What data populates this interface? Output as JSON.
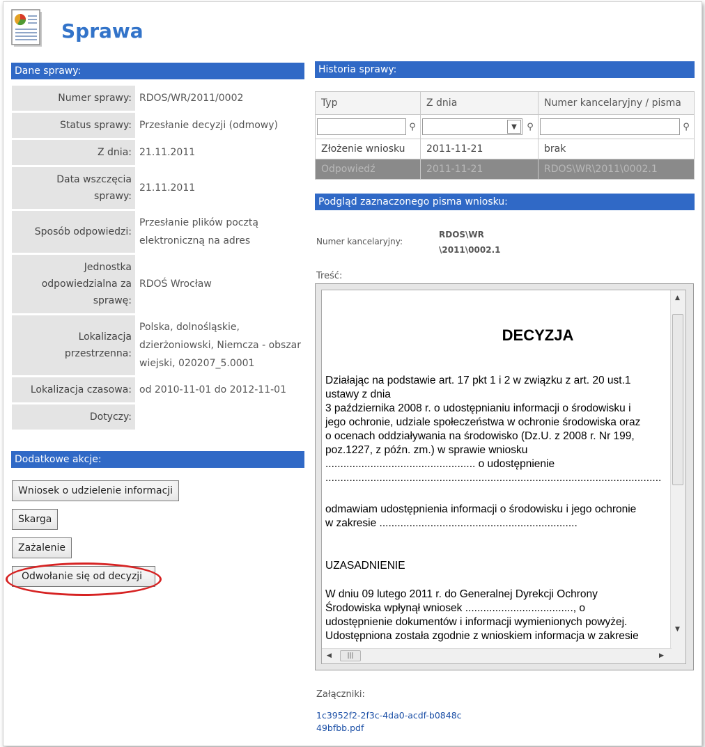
{
  "page": {
    "title": "Sprawa",
    "icon": "document-report-icon"
  },
  "details": {
    "header": "Dane sprawy:",
    "rows": [
      {
        "label": "Numer sprawy:",
        "value": "RDOS/WR/2011/0002"
      },
      {
        "label": "Status sprawy:",
        "value": "Przesłanie decyzji (odmowy)"
      },
      {
        "label": "Z dnia:",
        "value": "21.11.2011"
      },
      {
        "label": "Data wszczęcia sprawy:",
        "value": "21.11.2011"
      },
      {
        "label": "Sposób odpowiedzi:",
        "value": "Przesłanie plików pocztą elektroniczną na adres"
      },
      {
        "label": "Jednostka odpowiedzialna za sprawę:",
        "value": "RDOŚ Wrocław"
      },
      {
        "label": "Lokalizacja przestrzenna:",
        "value": "Polska, dolnośląskie, dzierżoniowski, Niemcza - obszar wiejski, 020207_5.0001"
      },
      {
        "label": "Lokalizacja czasowa:",
        "value": "od 2010-11-01 do 2012-11-01"
      },
      {
        "label": "Dotyczy:",
        "value": ""
      }
    ]
  },
  "actions": {
    "header": "Dodatkowe akcje:",
    "buttons": [
      {
        "label": "Wniosek o udzielenie informacji"
      },
      {
        "label": "Skarga"
      },
      {
        "label": "Zażalenie"
      },
      {
        "label": "Odwołanie się od decyzji"
      }
    ],
    "highlight_color": "#d62222"
  },
  "history": {
    "header": "Historia sprawy:",
    "columns": [
      "Typ",
      "Z dnia",
      "Numer kancelaryjny / pisma"
    ],
    "rows": [
      {
        "typ": "Złożenie wniosku",
        "date": "2011-11-21",
        "number": "brak"
      },
      {
        "typ": "Odpowiedź",
        "date": "2011-11-21",
        "number": "RDOS\\WR\\2011\\0002.1",
        "selected": true
      }
    ]
  },
  "preview": {
    "header": "Podgląd zaznaczonego pisma wniosku:",
    "kanc_label": "Numer kancelaryjny:",
    "kanc_value_line1": "RDOS\\WR",
    "kanc_value_line2": "\\2011\\0002.1",
    "tresc_label": "Treść:",
    "doc": {
      "heading": "DECYZJA",
      "p1": "Działając na podstawie art. 17 pkt 1 i 2 w związku z art. 20 ust.1\nustawy z dnia\n3 października 2008 r. o udostępnianiu informacji o środowisku i\njego ochronie, udziale społeczeństwa w ochronie środowiska oraz\no ocenach oddziaływania na środowisko (Dz.U. z 2008 r. Nr 199,\npoz.1227, z późn. zm.) w sprawie wniosku\n.................................................. o udostępnienie\n................................................................................................................",
      "p2": "odmawiam udostępnienia informacji o środowisku i jego ochronie\nw zakresie ..................................................................",
      "p3": "UZASADNIENIE",
      "p4": "W dniu 09 lutego 2011 r. do Generalnej Dyrekcji Ochrony\nŚrodowiska wpłynął wniosek ...................................., o\nudostępnienie dokumentów i informacji wymienionych powyżej.\nUdostępniona została zgodnie z wnioskiem informacja w zakresie"
    }
  },
  "attachments": {
    "label": "Załączniki:",
    "file": "1c3952f2-2f3c-4da0-acdf-b0848c49bfbb.pdf"
  },
  "colors": {
    "accent": "#3069c6",
    "title": "#3273c9",
    "selected_row": "#8a8a8a",
    "link": "#1b4fa6"
  }
}
